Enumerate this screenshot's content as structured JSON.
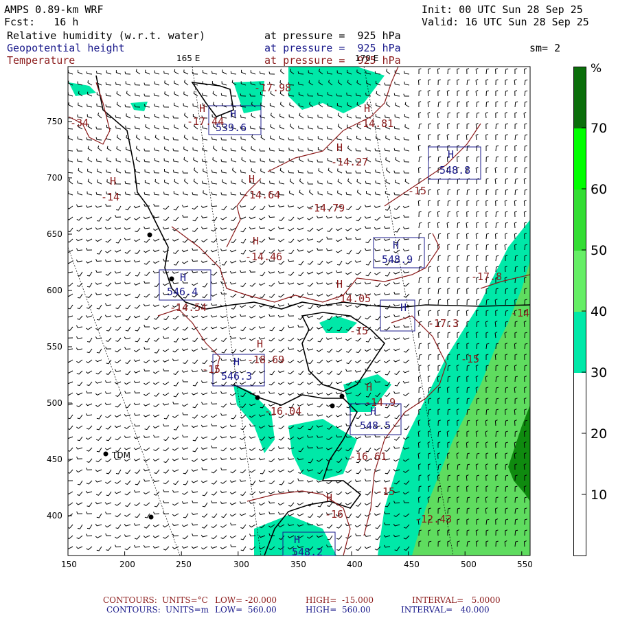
{
  "header": {
    "model": "AMPS 0.89-km WRF",
    "forecast": "Fcst:   16 h",
    "init": "Init: 00 UTC Sun 28 Sep 25",
    "valid": "Valid: 16 UTC Sun 28 Sep 25",
    "fields": [
      {
        "name": "Relative humidity (w.r.t. water)",
        "level": "at pressure =  925 hPa",
        "color": "#000000"
      },
      {
        "name": "Geopotential height",
        "level": "at pressure =  925 hPa",
        "color": "#1a1a8b"
      },
      {
        "name": "Temperature",
        "level": "at pressure =  925 hPa",
        "color": "#8b1a1a"
      }
    ],
    "smoothing": "sm= 2"
  },
  "map": {
    "x_ticks": [
      "150",
      "200",
      "250",
      "300",
      "350",
      "400",
      "450",
      "500",
      "550"
    ],
    "y_ticks": [
      "750",
      "700",
      "650",
      "600",
      "550",
      "500",
      "450",
      "400"
    ],
    "meridians": [
      "165 E",
      "170 E"
    ],
    "station_label": "TDM",
    "temperature_labels": [
      "-17.98",
      "-17.44",
      "-14.81",
      "-14.27",
      "-15",
      "-14.64",
      "-14.79",
      "-14.46",
      "-14",
      "-14.05",
      "-17.8",
      "-14.54",
      "-17.3",
      "-15",
      "-15",
      "-18.69",
      "-15",
      "-16.04",
      "-14.9",
      "-16.61",
      "-15",
      "-16",
      "-12.43",
      "-34",
      "-14"
    ],
    "height_labels": [
      "539.6",
      "548.8",
      "548.9",
      "546.4",
      "546.3",
      "548.5",
      "548.2"
    ],
    "high_marker": "H"
  },
  "legend": {
    "unit": "%",
    "labels": [
      "70",
      "60",
      "50",
      "40",
      "30",
      "20",
      "10"
    ],
    "colors": [
      "#0b6e0b",
      "#00ff00",
      "#33dd33",
      "#66ee66",
      "#00e8a8",
      "#ffffff"
    ]
  },
  "footer": {
    "line1": {
      "label": "CONTOURS:",
      "units": "UNITS=°C",
      "low": "LOW= -20.000",
      "high": "HIGH=  -15.000",
      "interval": "INTERVAL=   5.0000"
    },
    "line2": {
      "label": "CONTOURS:",
      "units": "UNITS=m",
      "low": "LOW=  560.00",
      "high": "HIGH=  560.00",
      "interval": "INTERVAL=   40.000"
    }
  },
  "colors": {
    "temperature": "#8b1a1a",
    "height": "#1a1a8b",
    "rh_low": "#00e8a8",
    "rh_mid": "#66ee66",
    "rh_high": "#0b6e0b"
  }
}
